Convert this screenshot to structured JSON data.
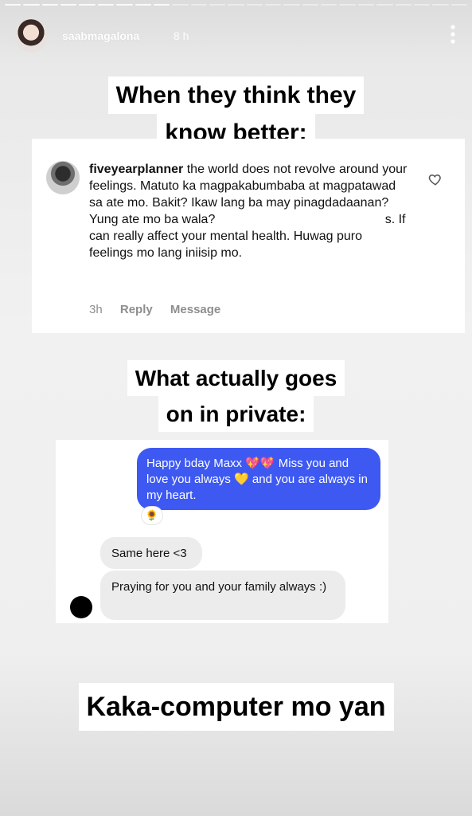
{
  "story": {
    "username": "saabmagalona",
    "time": "8 h"
  },
  "captions": {
    "top_line1": "When they think they",
    "top_line2": "know better:",
    "middle_line1": "What actually goes",
    "middle_line2": "on in private:",
    "bottom": "Kaka-computer mo yan"
  },
  "comment": {
    "username": "fiveyearplanner",
    "text_1": " the world does not revolve around your feelings. Matuto ka magpakabumbaba at magpatawad sa ate mo. Bakit? Ikaw lang ba may pinagdadaanan? Yung ate mo ba wala? ",
    "text_2": "s. If can really affect your mental health. Huwag puro feelings mo lang iniisip mo.",
    "time": "3h",
    "reply_label": "Reply",
    "message_label": "Message"
  },
  "dm": {
    "sent_message": "Happy bday Maxx 💖💖 Miss you and love you always 💛 and you are always in my heart.",
    "reaction": "🌻",
    "received_1": "Same here <3",
    "received_2": "Praying for you and your family always :)"
  },
  "icons": {
    "more": "more-vertical-icon",
    "heart": "heart-outline-icon"
  },
  "colors": {
    "sent_bubble": "#3d59f2",
    "received_bubble": "#ececec"
  }
}
